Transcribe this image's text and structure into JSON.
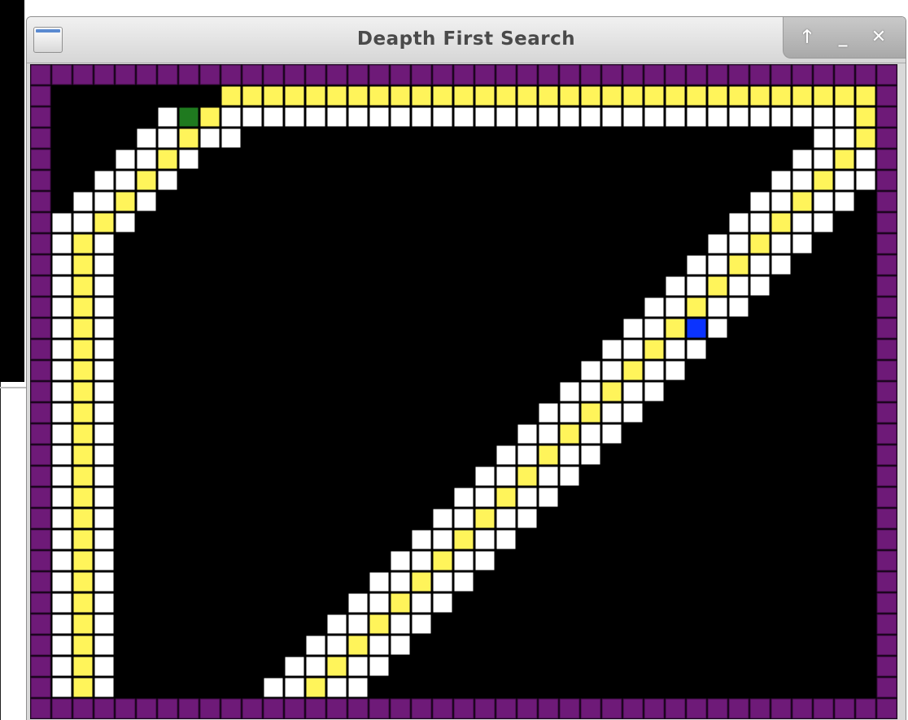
{
  "window": {
    "title": "Deapth First Search"
  },
  "title_controls": {
    "maximize_glyph": "🡑",
    "minimize_glyph": "_",
    "close_glyph": "✕"
  },
  "grid": {
    "columns": 41,
    "rows": 31,
    "colors": {
      "wall": "#6e1a78",
      "wall_border": "#3a0a40",
      "empty": "#000000",
      "visited": "#ffffff",
      "path": "#fff45a",
      "start": "#1f7a1f",
      "goal": "#0b33ff",
      "cell_border": "#000000"
    },
    "start_cell": [
      7,
      2
    ],
    "goal_cell": [
      31,
      12
    ]
  }
}
